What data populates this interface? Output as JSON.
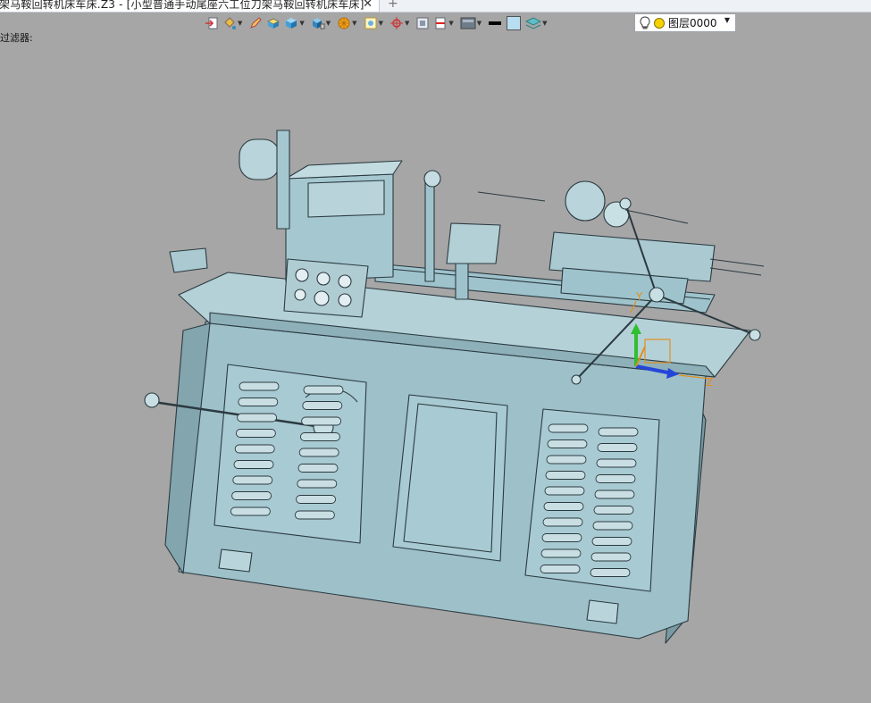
{
  "window": {
    "tab_title": "架马鞍回转机床车床.Z3 - [小型普通手动尾座六工位刀架马鞍回转机床车床]",
    "tab_close": "✕",
    "tab_new": "+"
  },
  "toolbar": {
    "tools": [
      {
        "name": "export-icon",
        "dropdown": false
      },
      {
        "name": "paint-bucket-icon",
        "dropdown": true
      },
      {
        "name": "pencil-icon",
        "dropdown": false
      },
      {
        "name": "face-color-icon",
        "dropdown": false
      },
      {
        "name": "solid-box-icon",
        "dropdown": true
      },
      {
        "name": "display-mode-icon",
        "dropdown": true
      },
      {
        "name": "render-style-icon",
        "dropdown": true
      },
      {
        "name": "view-fit-icon",
        "dropdown": true
      },
      {
        "name": "orient-icon",
        "dropdown": true
      },
      {
        "name": "section-icon",
        "dropdown": false
      },
      {
        "name": "clip-plane-icon",
        "dropdown": true
      },
      {
        "name": "background-icon",
        "dropdown": true
      },
      {
        "name": "line-color-icon",
        "dropdown": false
      },
      {
        "name": "fill-color-icon",
        "dropdown": false
      },
      {
        "name": "layer-manager-icon",
        "dropdown": true
      }
    ],
    "layer": {
      "name": "图层0000",
      "bulb_icon": "lightbulb-icon",
      "status_color": "#f5d300"
    }
  },
  "filter": {
    "label": "过滤器:"
  },
  "viewport": {
    "background": "#a6a6a6",
    "model_color": "#9fc3cc",
    "axes": {
      "y": "Y",
      "z": "Z",
      "y_color": "#2fbf2f",
      "z_color": "#2446d8",
      "x_color": "#e09020"
    }
  }
}
